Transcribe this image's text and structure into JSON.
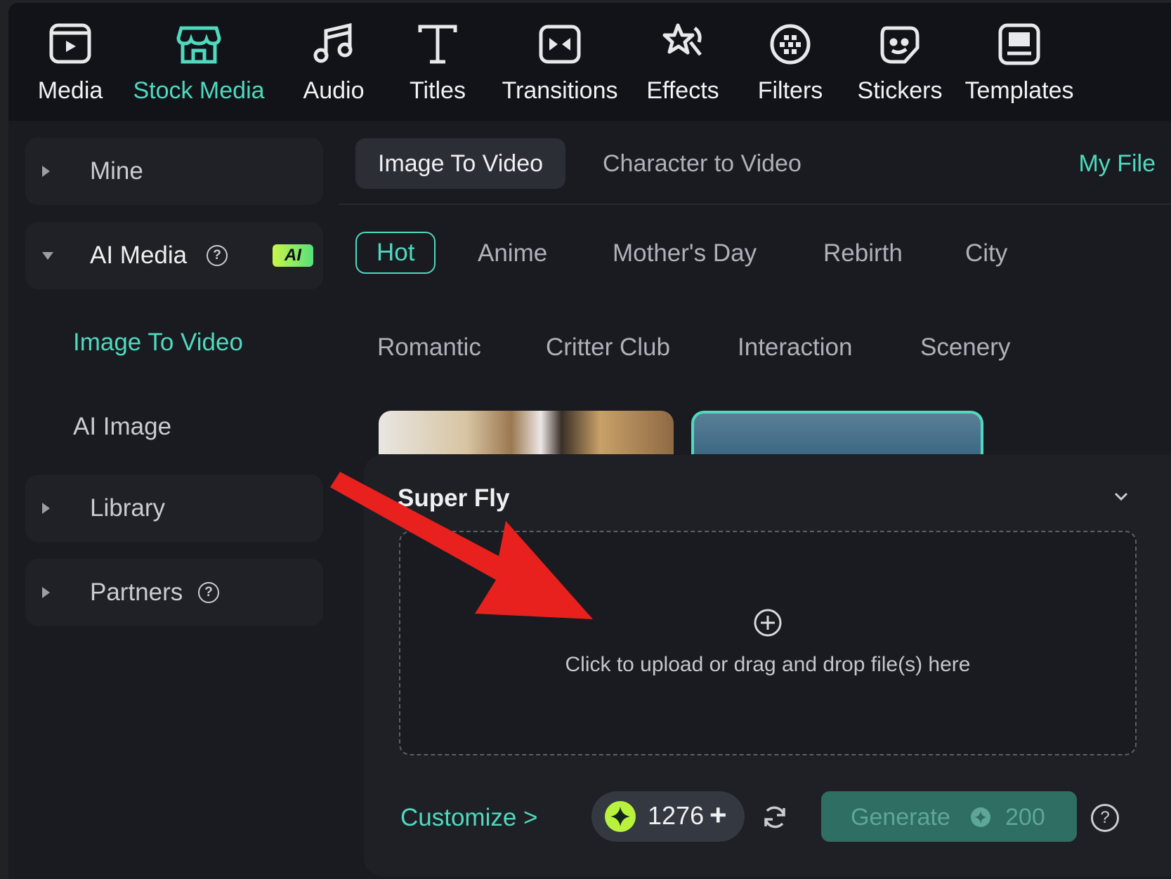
{
  "toolbar": {
    "items": [
      {
        "label": "Media",
        "icon": "media-icon"
      },
      {
        "label": "Stock Media",
        "icon": "stock-media-icon",
        "active": true
      },
      {
        "label": "Audio",
        "icon": "music-note-icon"
      },
      {
        "label": "Titles",
        "icon": "text-t-icon"
      },
      {
        "label": "Transitions",
        "icon": "transitions-icon"
      },
      {
        "label": "Effects",
        "icon": "effects-star-icon"
      },
      {
        "label": "Filters",
        "icon": "filters-icon"
      },
      {
        "label": "Stickers",
        "icon": "sticker-icon"
      },
      {
        "label": "Templates",
        "icon": "templates-icon"
      }
    ]
  },
  "sidebar": {
    "mine": "Mine",
    "ai_media": "AI Media",
    "ai_badge": "AI",
    "help_glyph": "?",
    "sub_items": [
      "Image To Video",
      "AI Image"
    ],
    "library": "Library",
    "partners": "Partners"
  },
  "tabs": {
    "items": [
      "Image To Video",
      "Character to Video"
    ],
    "my_file": "My File"
  },
  "categories": {
    "row1": [
      "Hot",
      "Anime",
      "Mother's Day",
      "Rebirth",
      "City"
    ],
    "row2": [
      "Romantic",
      "Critter Club",
      "Interaction",
      "Scenery"
    ]
  },
  "panel": {
    "title": "Super Fly",
    "upload_text": "Click to upload or drag and drop file(s) here",
    "customize": "Customize >",
    "credits": "1276",
    "plus": "+",
    "generate_label": "Generate",
    "generate_cost": "200",
    "help_glyph": "?"
  },
  "colors": {
    "accent": "#4fd9bf",
    "annotation_arrow": "#e8201e",
    "ai_badge": "#c8f54a"
  }
}
